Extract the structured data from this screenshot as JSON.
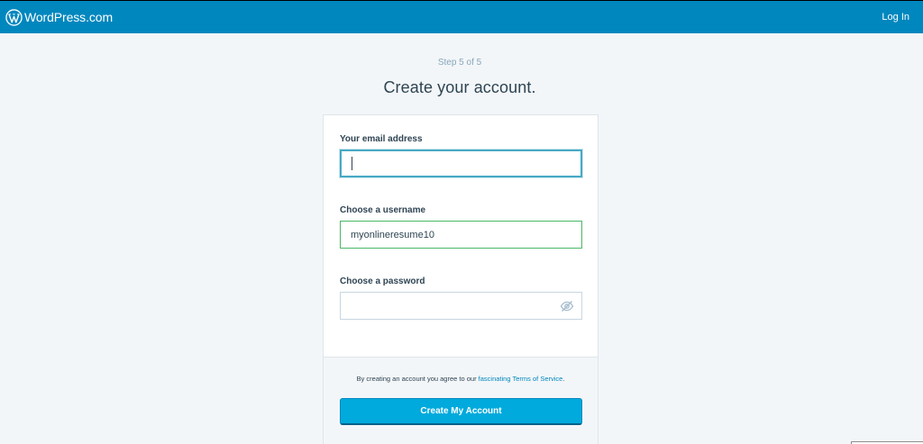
{
  "header": {
    "brand": "WordPress.com",
    "login_label": "Log In",
    "bar_color": "#0087be"
  },
  "signup": {
    "step": "Step 5 of 5",
    "title": "Create your account."
  },
  "form": {
    "email_label": "Your email address",
    "email_value": "",
    "username_label": "Choose a username",
    "username_value": "myonlineresume10",
    "password_label": "Choose a password",
    "password_value": ""
  },
  "footer": {
    "terms_prefix": "By creating an account you agree to our ",
    "terms_link": "fascinating Terms of Service",
    "terms_suffix": ".",
    "create_label": "Create My Account",
    "button_color": "#00aadc"
  },
  "icons": {
    "logo": "wordpress-logo-icon",
    "password_toggle": "eye-slash-icon"
  }
}
